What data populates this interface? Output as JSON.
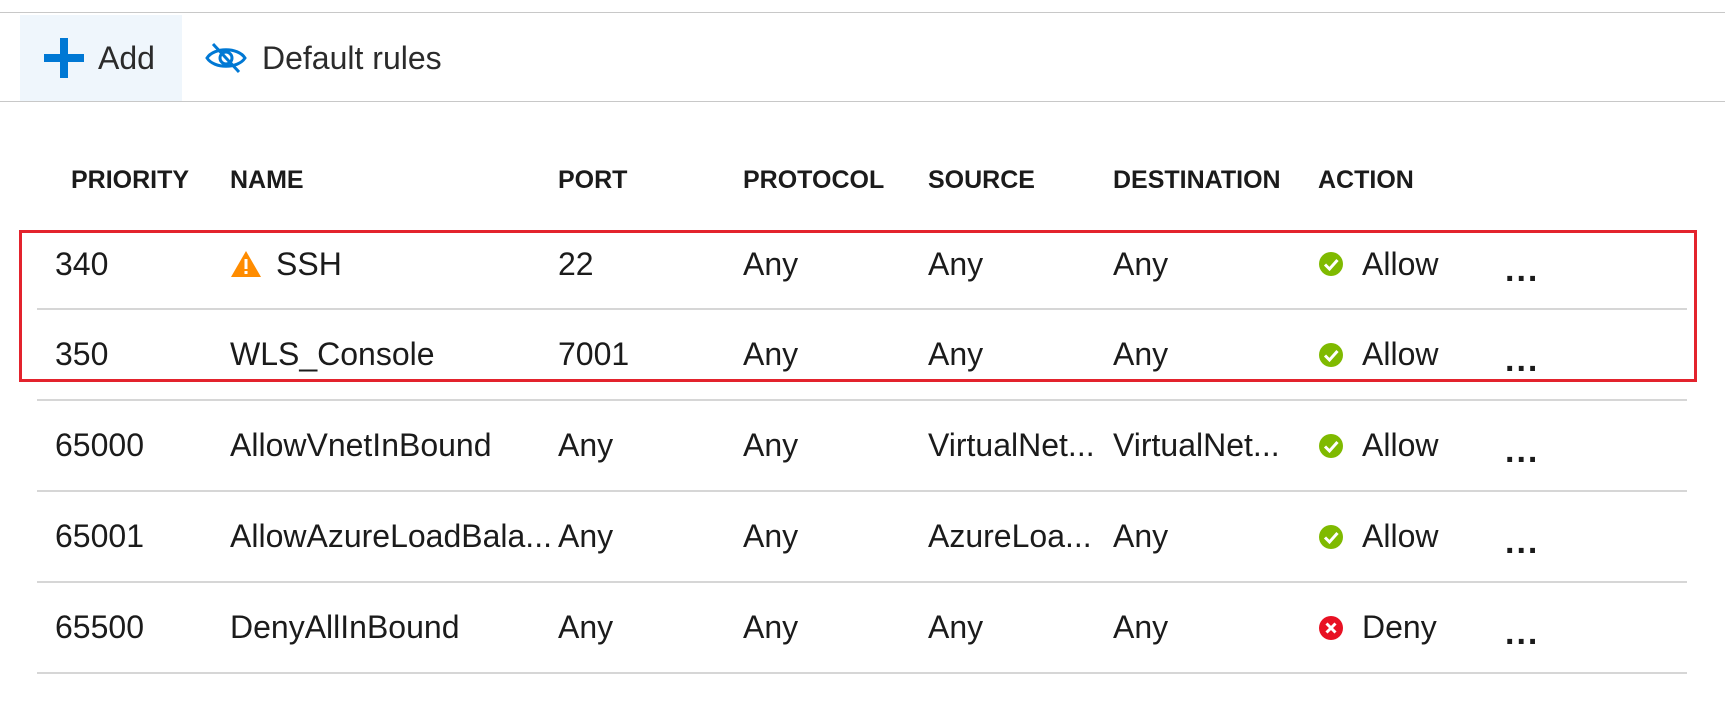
{
  "toolbar": {
    "add_label": "Add",
    "default_rules_label": "Default rules",
    "accent_color": "#0078d4"
  },
  "table": {
    "headers": [
      "PRIORITY",
      "NAME",
      "PORT",
      "PROTOCOL",
      "SOURCE",
      "DESTINATION",
      "ACTION"
    ],
    "rows": [
      {
        "priority": "340",
        "name": "SSH",
        "warning": true,
        "port": "22",
        "protocol": "Any",
        "source": "Any",
        "destination": "Any",
        "action": "Allow",
        "status": "allow"
      },
      {
        "priority": "350",
        "name": "WLS_Console",
        "warning": false,
        "port": "7001",
        "protocol": "Any",
        "source": "Any",
        "destination": "Any",
        "action": "Allow",
        "status": "allow"
      },
      {
        "priority": "65000",
        "name": "AllowVnetInBound",
        "warning": false,
        "port": "Any",
        "protocol": "Any",
        "source": "VirtualNet...",
        "destination": "VirtualNet...",
        "action": "Allow",
        "status": "allow"
      },
      {
        "priority": "65001",
        "name": "AllowAzureLoadBala...",
        "warning": false,
        "port": "Any",
        "protocol": "Any",
        "source": "AzureLoa...",
        "destination": "Any",
        "action": "Allow",
        "status": "allow"
      },
      {
        "priority": "65500",
        "name": "DenyAllInBound",
        "warning": false,
        "port": "Any",
        "protocol": "Any",
        "source": "Any",
        "destination": "Any",
        "action": "Deny",
        "status": "deny"
      }
    ],
    "more_label": "...",
    "highlighted_rows": [
      "340",
      "350"
    ]
  },
  "colors": {
    "allow": "#7fba00",
    "deny": "#e81123",
    "warning": "#ff8c00",
    "highlight_border": "#e3232d"
  },
  "icons": {
    "add": "plus-icon",
    "default_rules": "eye-hidden-icon",
    "warning": "warning-triangle-icon",
    "allow": "check-circle-icon",
    "deny": "x-circle-icon"
  }
}
